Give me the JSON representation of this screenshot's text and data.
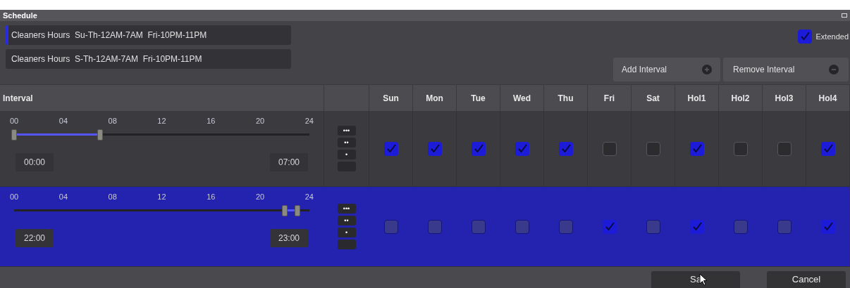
{
  "window": {
    "title": "Schedule"
  },
  "names": [
    {
      "value": "Cleaners Hours  Su-Th-12AM-7AM  Fri-10PM-11PM",
      "selected": true
    },
    {
      "value": "Cleaners Hours  S-Th-12AM-7AM  Fri-10PM-11PM",
      "selected": false
    }
  ],
  "extended": {
    "label": "Extended",
    "checked": true
  },
  "buttons": {
    "add": "Add Interval",
    "remove": "Remove Interval"
  },
  "table": {
    "interval_header": "Interval",
    "days": [
      "Sun",
      "Mon",
      "Tue",
      "Wed",
      "Thu",
      "Fri",
      "Sat",
      "Hol1",
      "Hol2",
      "Hol3",
      "Hol4"
    ],
    "rows": [
      {
        "selected": false,
        "ticks": [
          "00",
          "04",
          "08",
          "12",
          "16",
          "20",
          "24"
        ],
        "thumbs": [
          {
            "level": 0
          },
          {
            "level": 0.2917
          }
        ],
        "start": "00:00",
        "end": "07:00",
        "dot_buttons": [
          "•••",
          "••",
          "•"
        ],
        "days": [
          true,
          true,
          true,
          true,
          true,
          false,
          false,
          true,
          false,
          false,
          true
        ]
      },
      {
        "selected": true,
        "ticks": [
          "00",
          "04",
          "08",
          "12",
          "16",
          "20",
          "24"
        ],
        "thumbs": [
          {
            "level": 0.9167
          },
          {
            "level": 0.9583
          }
        ],
        "start": "22:00",
        "end": "23:00",
        "dot_buttons": [
          "•••",
          "••",
          "•"
        ],
        "days": [
          false,
          false,
          false,
          false,
          false,
          true,
          false,
          true,
          false,
          false,
          true
        ]
      }
    ]
  },
  "footer": {
    "save": "Sa",
    "cancel": "Cancel"
  }
}
